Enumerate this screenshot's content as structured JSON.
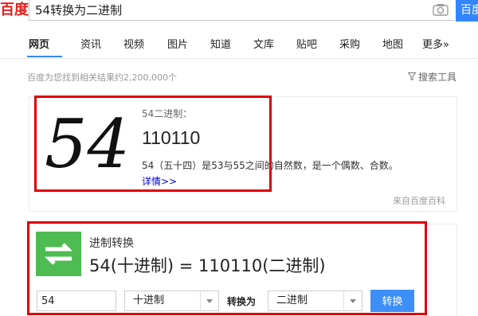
{
  "header": {
    "logo_text": "百度",
    "search_value": "54转换为二进制",
    "search_button": "百度一下"
  },
  "tabs": [
    {
      "label": "网页",
      "active": true
    },
    {
      "label": "资讯"
    },
    {
      "label": "视频"
    },
    {
      "label": "图片"
    },
    {
      "label": "知道"
    },
    {
      "label": "文库"
    },
    {
      "label": "贴吧"
    },
    {
      "label": "采购"
    },
    {
      "label": "地图"
    },
    {
      "label": "更多»"
    }
  ],
  "results_info": {
    "count_text": "百度为您找到相关结果约2,200,000个",
    "tools_label": "搜索工具"
  },
  "number_card": {
    "big_number": "54",
    "title": "54二进制：",
    "value": "110110",
    "description": "54（五十四）是53与55之间的自然数，是一个偶数、合数。",
    "more_link": "详情>>",
    "source": "来自百度百科"
  },
  "converter_card": {
    "title": "进制转换",
    "result": "54(十进制) = 110110(二进制)",
    "input_value": "54",
    "from_base": "十进制",
    "to_label": "转换为",
    "to_base": "二进制",
    "convert_button": "转换"
  },
  "colors": {
    "accent": "#3385ff",
    "highlight_box": "#e00000",
    "converter_icon": "#4fbc53",
    "logo": "#de1f1f"
  }
}
